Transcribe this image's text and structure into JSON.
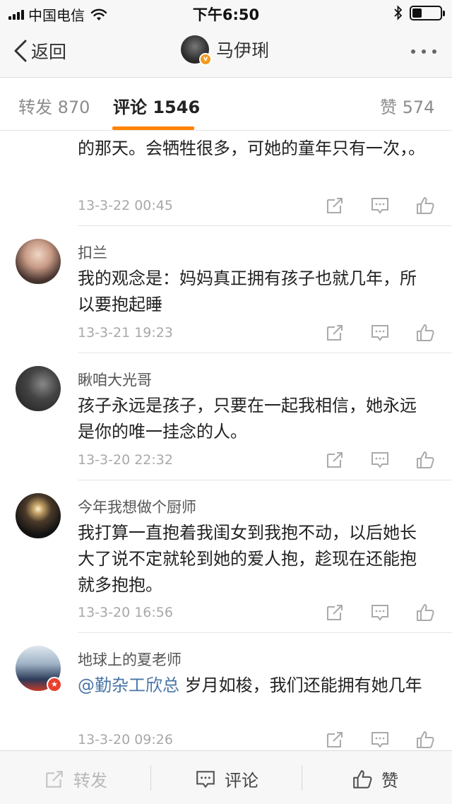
{
  "status_bar": {
    "carrier": "中国电信",
    "time": "下午6:50",
    "battery_level": 0.35
  },
  "nav": {
    "back_label": "返回",
    "user_name": "马伊琍",
    "verified_badge": "v"
  },
  "tabs": {
    "repost_label": "转发",
    "repost_count": "870",
    "comment_label": "评论",
    "comment_count": "1546",
    "like_label": "赞",
    "like_count": "574"
  },
  "comments": [
    {
      "name": "",
      "text": "的那天。会牺牲很多，可她的童年只有一次，。",
      "time": "13-3-22 00:45"
    },
    {
      "name": "扣兰",
      "text": "我的观念是：妈妈真正拥有孩子也就几年，所以要抱起睡",
      "time": "13-3-21 19:23"
    },
    {
      "name": "瞅咱大光哥",
      "text": "孩子永远是孩子，只要在一起我相信，她永远是你的唯一挂念的人。",
      "time": "13-3-20 22:32"
    },
    {
      "name": "今年我想做个厨师",
      "text": "我打算一直抱着我闺女到我抱不动，以后她长大了说不定就轮到她的爱人抱，趁现在还能抱就多抱抱。",
      "time": "13-3-20 16:56"
    },
    {
      "name": "地球上的夏老师",
      "mention": "@勤杂工欣总",
      "text": " 岁月如梭，我们还能拥有她几年",
      "time": "13-3-20 09:26"
    }
  ],
  "bottom_bar": {
    "repost_label": "转发",
    "comment_label": "评论",
    "like_label": "赞"
  },
  "icons": [
    "back-chevron-icon",
    "more-dots-icon",
    "share-icon",
    "comment-icon",
    "like-icon",
    "wifi-icon",
    "bluetooth-icon",
    "battery-icon"
  ],
  "colors": {
    "accent": "#ff8200",
    "mention": "#4a75a7",
    "muted": "#a8a8a8"
  }
}
